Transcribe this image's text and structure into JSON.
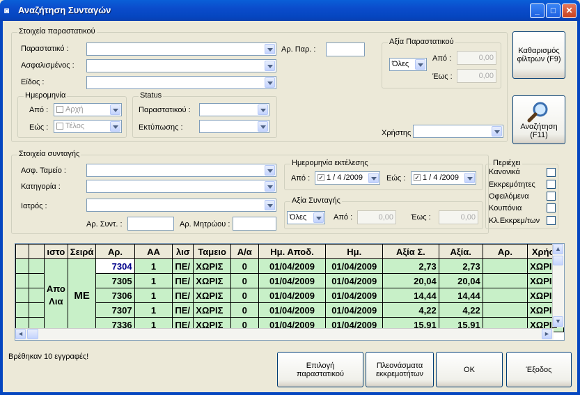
{
  "window": {
    "title": "Αναζήτηση Συνταγών"
  },
  "doc_group": {
    "title": "Στοιχεία παραστατικού",
    "parastatiko_label": "Παραστατικό :",
    "asfalismenos_label": "Ασφαλισμένος :",
    "eidos_label": "Είδος :",
    "ar_par_label": "Αρ. Παρ. :",
    "axia_group": {
      "title": "Αξία Παραστατικού",
      "select": "Όλες",
      "apo_label": "Από :",
      "eos_label": "Έως :",
      "apo_value": "0,00",
      "eos_value": "0,00"
    },
    "date_group": {
      "title": "Ημερομηνία",
      "apo_label": "Από :",
      "eos_label": "Εώς :",
      "apo_value": "Αρχή",
      "eos_value": "Τέλος"
    },
    "status_group": {
      "title": "Status",
      "parastatikou_label": "Παραστατικού :",
      "ektyposis_label": "Εκτύπωσης :"
    },
    "xristis_label": "Χρήστης"
  },
  "buttons": {
    "clear": "Καθαρισμός φίλτρων (F9)",
    "search": "Αναζήτηση (F11)",
    "epilogi": "Επιλογή παραστατικού",
    "pleonasmata": "Πλεονάσματα εκκρεμοτήτων",
    "ok": "OK",
    "exit": "Έξοδος"
  },
  "rx_group": {
    "title": "Στοιχεία συνταγής",
    "tameio_label": "Ασφ. Ταμείο :",
    "katigoria_label": "Κατηγορία :",
    "iatros_label": "Ιατρός :",
    "ar_synt_label": "Αρ. Συντ. :",
    "ar_mitroou_label": "Αρ. Μητρώου :",
    "exec_date": {
      "title": "Ημερομηνία εκτέλεσης",
      "apo_label": "Από :",
      "eos_label": "Εώς :",
      "apo_value": "1 / 4 /2009",
      "eos_value": "1 / 4 /2009"
    },
    "axia_synt": {
      "title": "Αξία Συνταγής",
      "select": "Όλες",
      "apo_label": "Από :",
      "eos_label": "Έως :",
      "apo_value": "0,00",
      "eos_value": "0,00"
    },
    "periexei": {
      "title": "Περιέχει",
      "items": [
        "Κανονικά",
        "Εκκρεμότητες",
        "Οφειλόμενα",
        "Κουπόνια",
        "Κλ.Εκκρεμ/των"
      ]
    }
  },
  "grid": {
    "headers": [
      "",
      "",
      "ιστο",
      "Σειρά",
      "Αρ.",
      "ΑΑ",
      "λισ",
      "Ταμειο",
      "Α/α",
      "Ημ. Αποδ.",
      "Ημ.",
      "Αξία Σ.",
      "Αξία.",
      "Αρ.",
      "Χρήστ"
    ],
    "merged_col2": "Απο\nΛια",
    "merged_col3": "ΜΕ",
    "rows": [
      [
        "7304",
        "1",
        "ΠΕ/",
        "ΧΩΡΙΣ",
        "0",
        "01/04/2009",
        "01/04/2009",
        "2,73",
        "2,73",
        "",
        "ΧΩΡΙΣ"
      ],
      [
        "7305",
        "1",
        "ΠΕ/",
        "ΧΩΡΙΣ",
        "0",
        "01/04/2009",
        "01/04/2009",
        "20,04",
        "20,04",
        "",
        "ΧΩΡΙΣ"
      ],
      [
        "7306",
        "1",
        "ΠΕ/",
        "ΧΩΡΙΣ",
        "0",
        "01/04/2009",
        "01/04/2009",
        "14,44",
        "14,44",
        "",
        "ΧΩΡΙΣ"
      ],
      [
        "7307",
        "1",
        "ΠΕ/",
        "ΧΩΡΙΣ",
        "0",
        "01/04/2009",
        "01/04/2009",
        "4,22",
        "4,22",
        "",
        "ΧΩΡΙΣ"
      ],
      [
        "7336",
        "1",
        "ΠΕ/",
        "ΧΩΡΙΣ",
        "0",
        "01/04/2009",
        "01/04/2009",
        "15,91",
        "15,91",
        "",
        "ΧΩΡΙΣ"
      ]
    ]
  },
  "status": {
    "text": "Βρέθηκαν 10 εγγραφές!"
  }
}
